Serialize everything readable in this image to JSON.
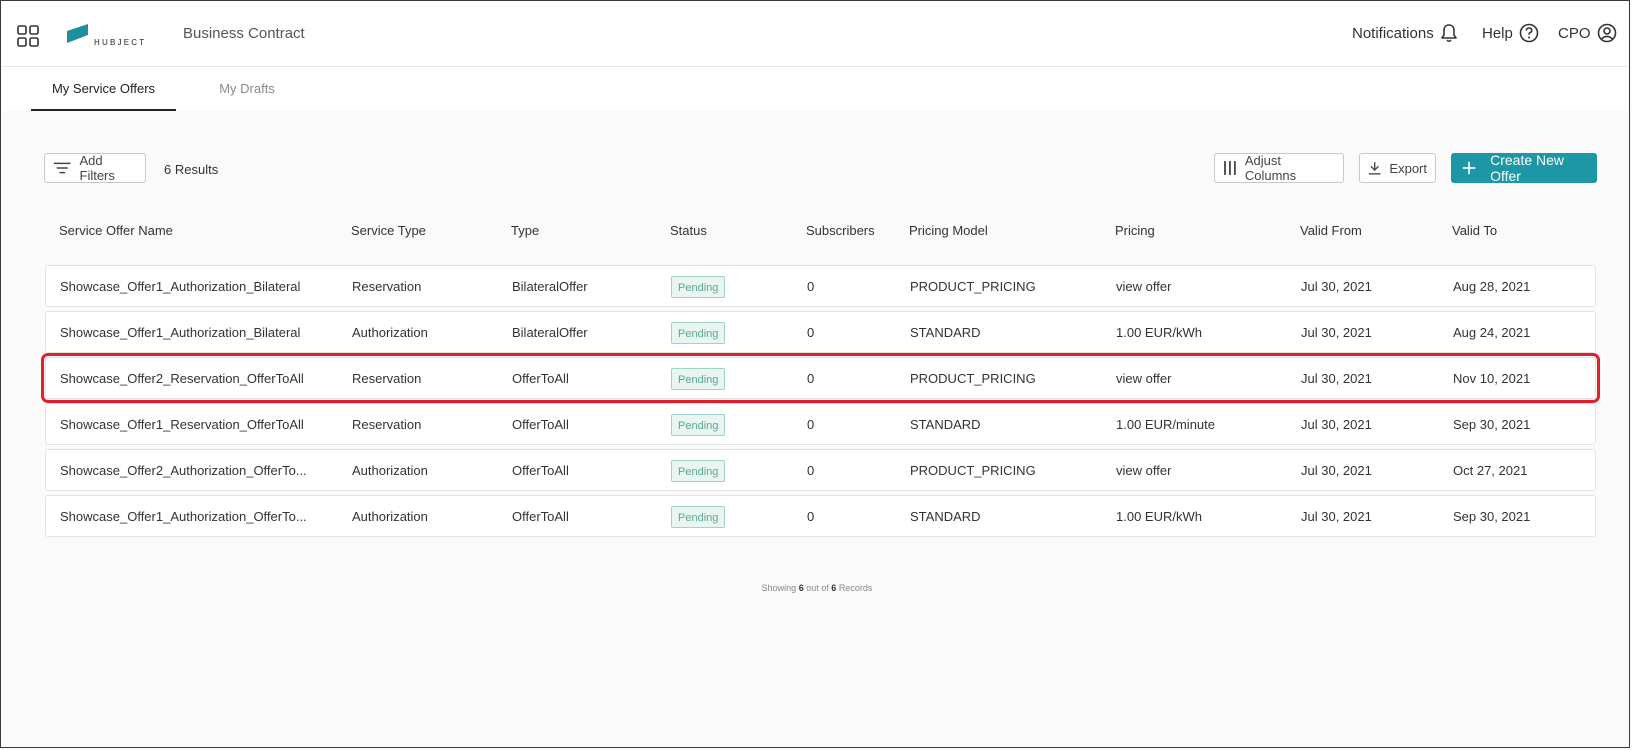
{
  "header": {
    "brand": "HUBJECT",
    "app_title": "Business Contract",
    "notifications_label": "Notifications",
    "help_label": "Help",
    "user_label": "CPO"
  },
  "tabs": [
    {
      "label": "My Service Offers",
      "active": true
    },
    {
      "label": "My Drafts",
      "active": false
    }
  ],
  "toolbar": {
    "add_filters_label": "Add Filters",
    "results_text": "6 Results",
    "adjust_columns_label": "Adjust Columns",
    "export_label": "Export",
    "create_label": "Create New Offer"
  },
  "table": {
    "columns": [
      "Service Offer Name",
      "Service Type",
      "Type",
      "Status",
      "Subscribers",
      "Pricing Model",
      "Pricing",
      "Valid From",
      "Valid To"
    ],
    "rows": [
      [
        "Showcase_Offer1_Authorization_Bilateral",
        "Reservation",
        "BilateralOffer",
        "Pending",
        "0",
        "PRODUCT_PRICING",
        "view offer",
        "Jul 30, 2021",
        "Aug 28, 2021"
      ],
      [
        "Showcase_Offer1_Authorization_Bilateral",
        "Authorization",
        "BilateralOffer",
        "Pending",
        "0",
        "STANDARD",
        "1.00 EUR/kWh",
        "Jul 30, 2021",
        "Aug 24, 2021"
      ],
      [
        "Showcase_Offer2_Reservation_OfferToAll",
        "Reservation",
        "OfferToAll",
        "Pending",
        "0",
        "PRODUCT_PRICING",
        "view offer",
        "Jul 30, 2021",
        "Nov 10, 2021"
      ],
      [
        "Showcase_Offer1_Reservation_OfferToAll",
        "Reservation",
        "OfferToAll",
        "Pending",
        "0",
        "STANDARD",
        "1.00 EUR/minute",
        "Jul 30, 2021",
        "Sep 30, 2021"
      ],
      [
        "Showcase_Offer2_Authorization_OfferTo...",
        "Authorization",
        "OfferToAll",
        "Pending",
        "0",
        "PRODUCT_PRICING",
        "view offer",
        "Jul 30, 2021",
        "Oct 27, 2021"
      ],
      [
        "Showcase_Offer1_Authorization_OfferTo...",
        "Authorization",
        "OfferToAll",
        "Pending",
        "0",
        "STANDARD",
        "1.00 EUR/kWh",
        "Jul 30, 2021",
        "Sep 30, 2021"
      ]
    ],
    "highlighted_row_index": 2
  },
  "footer": {
    "showing_prefix": "Showing",
    "shown_count": "6",
    "out_of": "out of",
    "total_count": "6",
    "records_label": "Records"
  },
  "colors": {
    "accent": "#1d96a6",
    "highlight_border": "#e0202a",
    "status_pending_bg": "#e8f5f1",
    "status_pending_text": "#5aa793"
  },
  "icons": [
    "app-grid-icon",
    "hubject-logo",
    "bell-icon",
    "help-circle-icon",
    "user-circle-icon",
    "filter-icon",
    "columns-icon",
    "download-icon",
    "plus-icon"
  ]
}
